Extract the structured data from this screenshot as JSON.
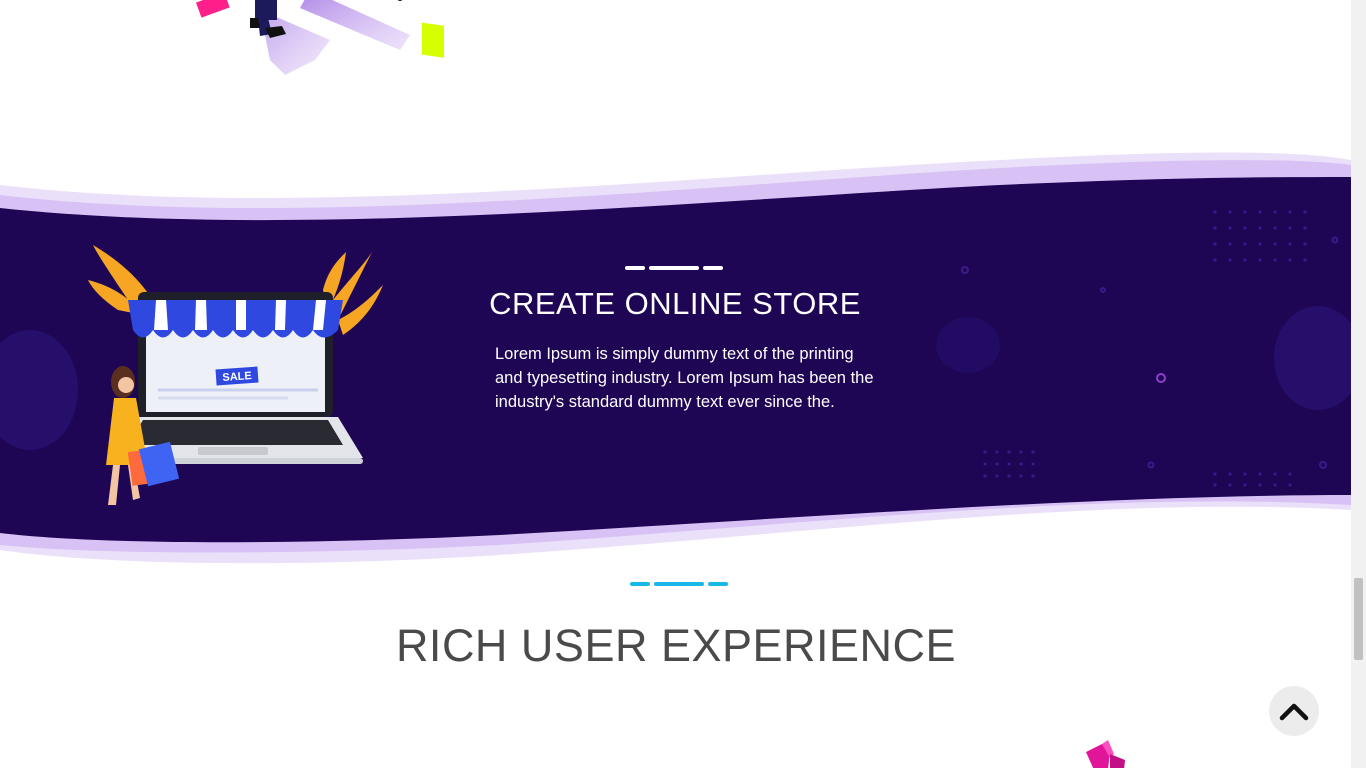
{
  "section_store": {
    "title": "CREATE ONLINE STORE",
    "description": "Lorem Ipsum is simply dummy text of the printing and typesetting industry. Lorem Ipsum has been the industry's standard dummy text ever since the.",
    "illustration_badge": "SALE"
  },
  "section_ux": {
    "title": "RICH USER EXPERIENCE"
  },
  "icons": {
    "scroll_top": "chevron-up-icon"
  },
  "colors": {
    "band_dark": "#1e0655",
    "band_light": "#d8c2f5",
    "band_lighter": "#ebe0fa",
    "title_dark": "#4a4a4a",
    "accent_cyan": "#1ab8e8",
    "accent_white": "#ffffff",
    "scroll_button_bg": "#ececec"
  }
}
